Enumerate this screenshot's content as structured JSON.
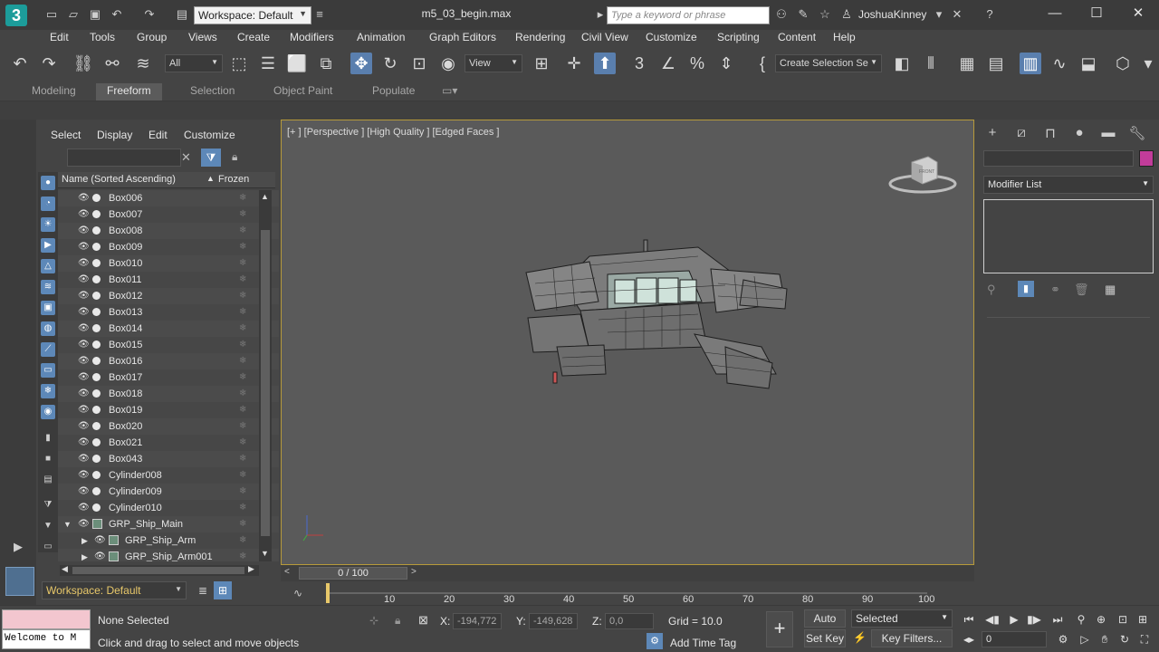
{
  "titlebar": {
    "workspace": "Workspace: Default",
    "document": "m5_03_begin.max",
    "search_placeholder": "Type a keyword or phrase",
    "user": "JoshuaKinney"
  },
  "menu": [
    "Edit",
    "Tools",
    "Group",
    "Views",
    "Create",
    "Modifiers",
    "Animation",
    "Graph Editors",
    "Rendering",
    "Civil View",
    "Customize",
    "Scripting",
    "Content",
    "Help"
  ],
  "toolbar": {
    "filter": "All",
    "ref_coord": "View",
    "selection_set": "Create Selection Se"
  },
  "ribbon": {
    "tabs": [
      "Modeling",
      "Freeform",
      "Selection",
      "Object Paint",
      "Populate"
    ],
    "active": "Freeform"
  },
  "explorer": {
    "menu": [
      "Select",
      "Display",
      "Edit",
      "Customize"
    ],
    "col_name": "Name (Sorted Ascending)",
    "col_frozen": "Frozen",
    "rows": [
      "Box006",
      "Box007",
      "Box008",
      "Box009",
      "Box010",
      "Box011",
      "Box012",
      "Box013",
      "Box014",
      "Box015",
      "Box016",
      "Box017",
      "Box018",
      "Box019",
      "Box020",
      "Box021",
      "Box043",
      "Cylinder008",
      "Cylinder009",
      "Cylinder010"
    ],
    "group_main": "GRP_Ship_Main",
    "children": [
      "GRP_Ship_Arm",
      "GRP_Ship_Arm001"
    ],
    "workspace": "Workspace: Default"
  },
  "viewport": {
    "label": "[+ ] [Perspective ] [High Quality ] [Edged Faces ]",
    "viewcube_face": "FRONT"
  },
  "command_panel": {
    "modifier_list": "Modifier List",
    "color": "#c23c9a"
  },
  "timeline": {
    "frame": "0 / 100",
    "ticks": [
      "10",
      "20",
      "30",
      "40",
      "50",
      "60",
      "70",
      "80",
      "90",
      "100"
    ]
  },
  "status": {
    "maxscript": "Welcome to M",
    "selection": "None Selected",
    "prompt": "Click and drag to select and move objects",
    "x_label": "X:",
    "x_value": "-194,772",
    "y_label": "Y:",
    "y_value": "-149,628",
    "z_label": "Z:",
    "z_value": "0,0",
    "grid": "Grid = 10.0",
    "add_time_tag": "Add Time Tag",
    "auto_key": "Auto Key",
    "set_key": "Set Key",
    "selected": "Selected",
    "key_filters": "Key Filters...",
    "current_frame": "0"
  }
}
